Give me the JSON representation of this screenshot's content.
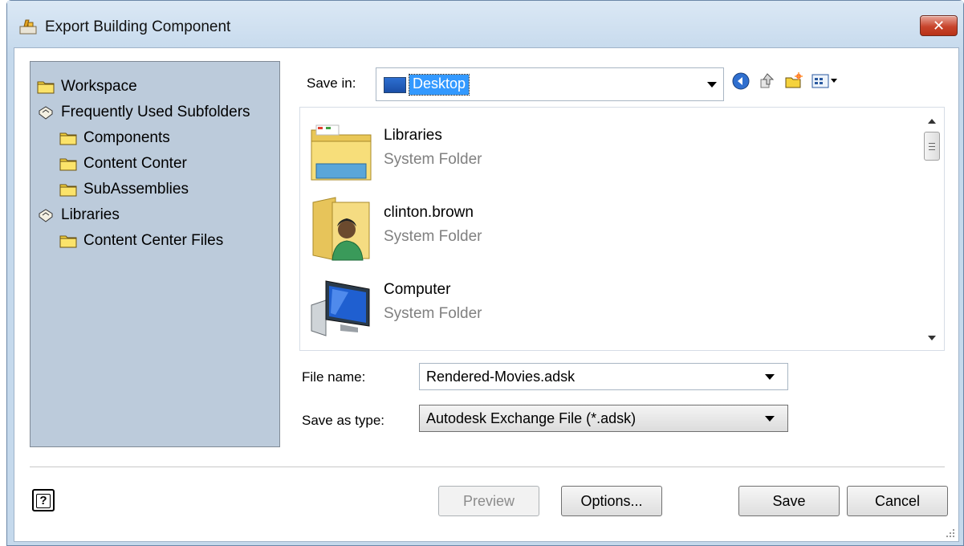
{
  "window": {
    "title": "Export Building Component",
    "close_glyph": "✕"
  },
  "sidebar": {
    "items": [
      {
        "label": "Workspace",
        "icon": "folder-icon"
      },
      {
        "label": "Frequently Used Subfolders",
        "icon": "shortcut-icon"
      },
      {
        "label": "Components",
        "icon": "folder-icon"
      },
      {
        "label": "Content Conter",
        "icon": "folder-icon"
      },
      {
        "label": "SubAssemblies",
        "icon": "folder-icon"
      },
      {
        "label": "Libraries",
        "icon": "shortcut-icon"
      },
      {
        "label": "Content Center Files",
        "icon": "folder-icon"
      }
    ]
  },
  "save_in": {
    "label": "Save in:",
    "value": "Desktop"
  },
  "files": [
    {
      "name": "Libraries",
      "type": "System Folder",
      "icon": "libraries-folder-icon"
    },
    {
      "name": "clinton.brown",
      "type": "System Folder",
      "icon": "user-folder-icon"
    },
    {
      "name": "Computer",
      "type": "System Folder",
      "icon": "computer-icon"
    }
  ],
  "file_name": {
    "label": "File name:",
    "value": "Rendered-Movies.adsk"
  },
  "save_as_type": {
    "label": "Save as type:",
    "value": "Autodesk Exchange File (*.adsk)"
  },
  "buttons": {
    "help": "?",
    "preview": "Preview",
    "options": "Options...",
    "save": "Save",
    "cancel": "Cancel"
  },
  "colors": {
    "selection": "#3399ff",
    "close_button": "#c8442c",
    "sidebar_bg": "#bccbdb"
  }
}
